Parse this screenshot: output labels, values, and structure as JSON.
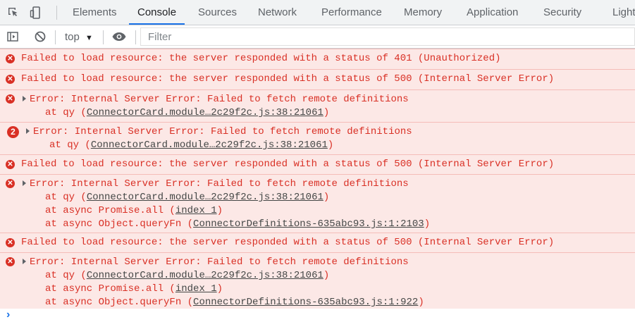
{
  "tabs": [
    {
      "label": "Elements",
      "active": false
    },
    {
      "label": "Console",
      "active": true
    },
    {
      "label": "Sources",
      "active": false
    },
    {
      "label": "Network",
      "active": false
    },
    {
      "label": "Performance",
      "active": false
    },
    {
      "label": "Memory",
      "active": false
    },
    {
      "label": "Application",
      "active": false
    },
    {
      "label": "Security",
      "active": false
    },
    {
      "label": "Light",
      "active": false
    }
  ],
  "toolbar": {
    "context_label": "top",
    "context_arrow": "▼",
    "filter_placeholder": "Filter"
  },
  "colors": {
    "error_text": "#d93025",
    "error_background": "#fce8e6",
    "active_tab_underline": "#1a73e8"
  },
  "messages": [
    {
      "type": "plain",
      "text": "Failed to load resource: the server responded with a status of 401 (Unauthorized)"
    },
    {
      "type": "plain",
      "text": "Failed to load resource: the server responded with a status of 500 (Internal Server Error)"
    },
    {
      "type": "error",
      "header": "Error: Internal Server Error: Failed to fetch remote definitions",
      "stack": [
        {
          "prefix": "at qy (",
          "link": "ConnectorCard.module…2c29f2c.js:38:21061",
          "suffix": ")"
        }
      ]
    },
    {
      "type": "error",
      "count": "2",
      "header": "Error: Internal Server Error: Failed to fetch remote definitions",
      "stack": [
        {
          "prefix": "at qy (",
          "link": "ConnectorCard.module…2c29f2c.js:38:21061",
          "suffix": ")"
        }
      ]
    },
    {
      "type": "plain",
      "text": "Failed to load resource: the server responded with a status of 500 (Internal Server Error)"
    },
    {
      "type": "error",
      "header": "Error: Internal Server Error: Failed to fetch remote definitions",
      "stack": [
        {
          "prefix": "at qy (",
          "link": "ConnectorCard.module…2c29f2c.js:38:21061",
          "suffix": ")"
        },
        {
          "prefix": "at async Promise.all (",
          "link": "index 1",
          "suffix": ")"
        },
        {
          "prefix": "at async Object.queryFn (",
          "link": "ConnectorDefinitions-635abc93.js:1:2103",
          "suffix": ")"
        }
      ]
    },
    {
      "type": "plain",
      "text": "Failed to load resource: the server responded with a status of 500 (Internal Server Error)"
    },
    {
      "type": "error",
      "header": "Error: Internal Server Error: Failed to fetch remote definitions",
      "stack": [
        {
          "prefix": "at qy (",
          "link": "ConnectorCard.module…2c29f2c.js:38:21061",
          "suffix": ")"
        },
        {
          "prefix": "at async Promise.all (",
          "link": "index 1",
          "suffix": ")"
        },
        {
          "prefix": "at async Object.queryFn (",
          "link": "ConnectorDefinitions-635abc93.js:1:922",
          "suffix": ")"
        }
      ]
    }
  ],
  "prompt_symbol": "›"
}
